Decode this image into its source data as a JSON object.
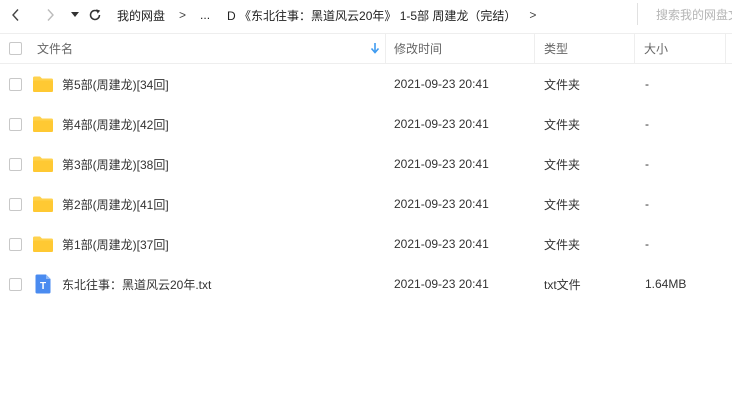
{
  "toolbar": {
    "back_icon": "chevron-left-icon",
    "forward_icon": "chevron-right-icon",
    "history_icon": "caret-down-icon",
    "refresh_icon": "refresh-icon",
    "breadcrumbs": [
      "我的网盘",
      "...",
      "D 《东北往事：黑道风云20年》 1-5部 周建龙（完结）"
    ],
    "separator": ">",
    "search_placeholder": "搜索我的网盘文"
  },
  "header": {
    "name": "文件名",
    "modified": "修改时间",
    "type": "类型",
    "size": "大小"
  },
  "files": [
    {
      "name": "第5部(周建龙)[34回]",
      "modified": "2021-09-23 20:41",
      "type": "文件夹",
      "size": "-",
      "icon": "folder-icon"
    },
    {
      "name": "第4部(周建龙)[42回]",
      "modified": "2021-09-23 20:41",
      "type": "文件夹",
      "size": "-",
      "icon": "folder-icon"
    },
    {
      "name": "第3部(周建龙)[38回]",
      "modified": "2021-09-23 20:41",
      "type": "文件夹",
      "size": "-",
      "icon": "folder-icon"
    },
    {
      "name": "第2部(周建龙)[41回]",
      "modified": "2021-09-23 20:41",
      "type": "文件夹",
      "size": "-",
      "icon": "folder-icon"
    },
    {
      "name": "第1部(周建龙)[37回]",
      "modified": "2021-09-23 20:41",
      "type": "文件夹",
      "size": "-",
      "icon": "folder-icon"
    },
    {
      "name": "东北往事：黑道风云20年.txt",
      "modified": "2021-09-23 20:41",
      "type": "txt文件",
      "size": "1.64MB",
      "icon": "text-file-icon",
      "icon_letter": "T"
    }
  ],
  "colors": {
    "folder": "#ffd24d",
    "text_file": "#4a8bf0",
    "sort_arrow": "#3f9bf0"
  }
}
